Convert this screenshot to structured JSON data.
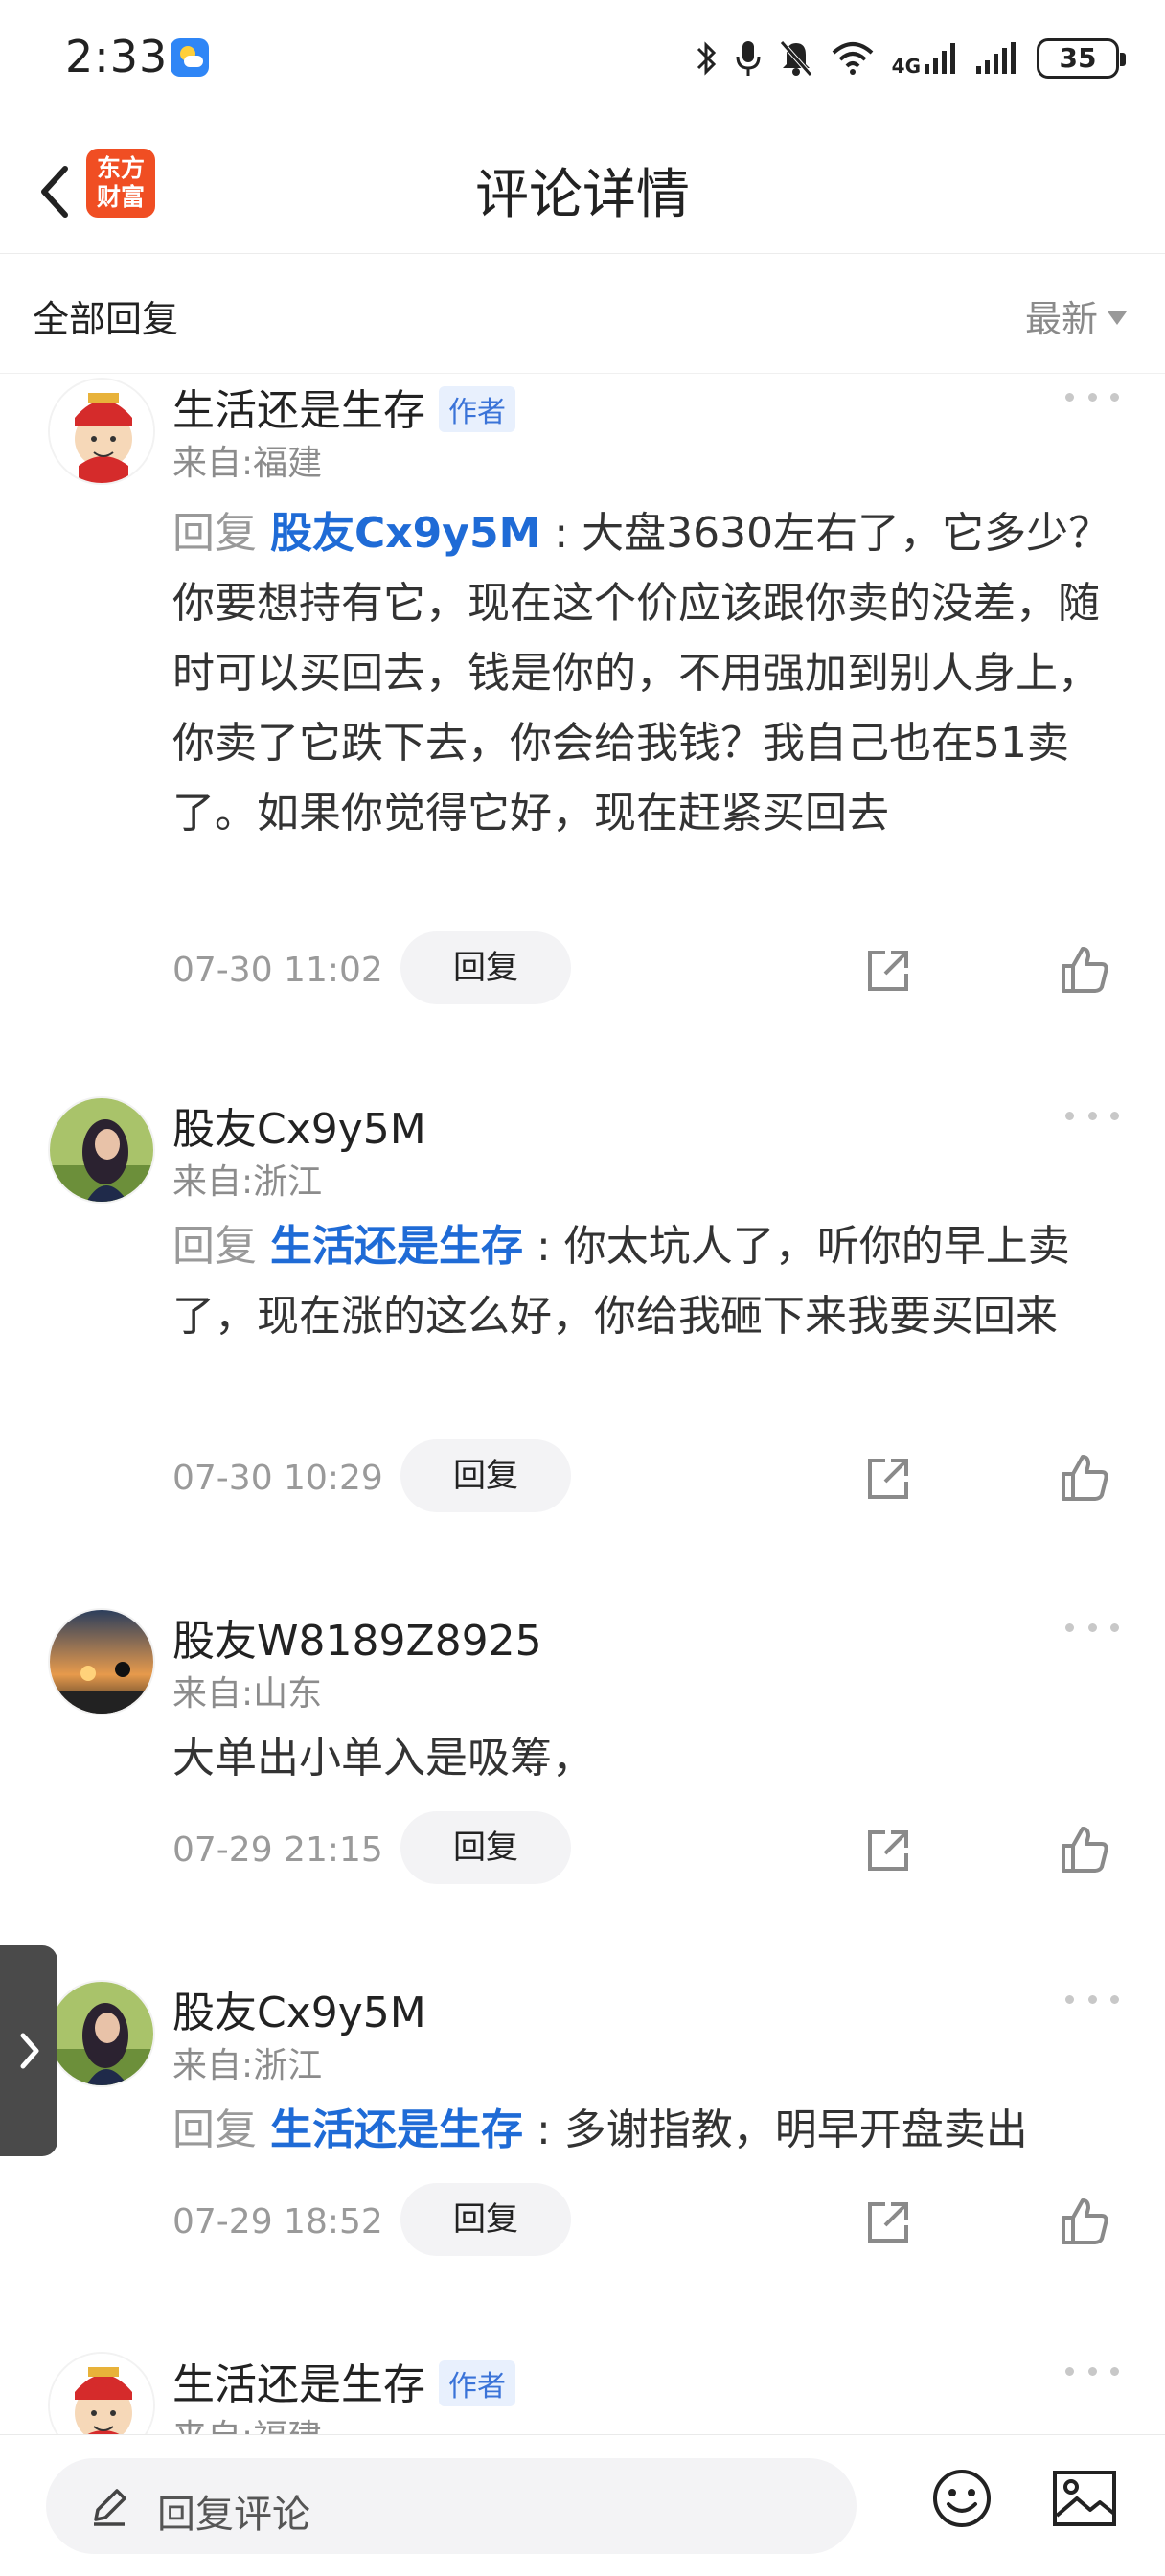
{
  "status_bar": {
    "time": "2:33",
    "network": "4G",
    "battery": "35",
    "icons": [
      "weather-icon",
      "bluetooth-icon",
      "mic-icon",
      "mute-bell-icon",
      "wifi-icon",
      "signal-icon",
      "battery-icon"
    ]
  },
  "header": {
    "title": "评论详情",
    "logo_line1": "东方",
    "logo_line2": "财富",
    "brand_color": "#f04e23"
  },
  "sort": {
    "all_label": "全部回复",
    "selected": "最新"
  },
  "comments": [
    {
      "name": "生活还是生存",
      "tag": "作者",
      "location": "来自:福建",
      "reply_prefix": "回复 ",
      "reply_target": "股友Cx9y5M",
      "reply_sep": " : ",
      "text": "大盘3630左右了，它多少？你要想持有它，现在这个价应该跟你卖的没差，随时可以买回去，钱是你的，不用强加到别人身上，你卖了它跌下去，你会给我钱？我自己也在51卖了。如果你觉得它好，现在赶紧买回去",
      "time": "07-30 11:02",
      "reply_label": "回复"
    },
    {
      "name": "股友Cx9y5M",
      "location": "来自:浙江",
      "reply_prefix": "回复 ",
      "reply_target": "生活还是生存",
      "reply_sep": " : ",
      "text": "你太坑人了，听你的早上卖了，现在涨的这么好，你给我砸下来我要买回来",
      "time": "07-30 10:29",
      "reply_label": "回复"
    },
    {
      "name": "股友W8189Z8925",
      "location": "来自:山东",
      "text": "大单出小单入是吸筹，",
      "time": "07-29 21:15",
      "reply_label": "回复"
    },
    {
      "name": "股友Cx9y5M",
      "location": "来自:浙江",
      "reply_prefix": "回复 ",
      "reply_target": "生活还是生存",
      "reply_sep": " : ",
      "text": "多谢指教，明早开盘卖出",
      "time": "07-29 18:52",
      "reply_label": "回复"
    },
    {
      "name": "生活还是生存",
      "tag": "作者",
      "location": "来自:福建"
    }
  ],
  "bottom_bar": {
    "input_placeholder": "回复评论"
  },
  "colors": {
    "link_blue": "#1f6bd6",
    "muted": "#9a9a9a"
  }
}
